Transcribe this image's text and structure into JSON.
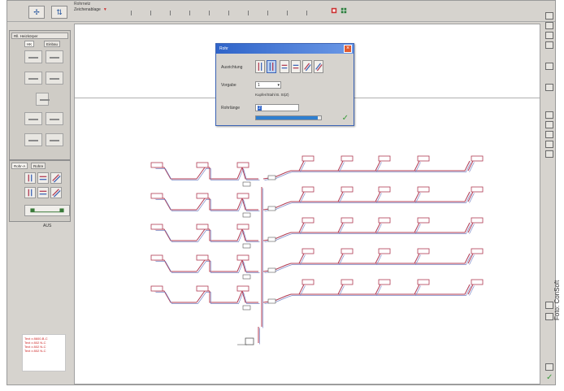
{
  "toolbar": {
    "layer_title": "Rohrnetz",
    "layer_value": "Zeichenablage",
    "layer_arrow": "▼"
  },
  "left_panel": {
    "title": "Rll. Heizkörper",
    "tabs": [
      "HK",
      "Einbau"
    ]
  },
  "left_panel2": {
    "tabs": [
      "Rohr-A",
      "Rohre"
    ],
    "count_label": "AUS"
  },
  "legend": {
    "lines": [
      "Text x 8600-B-C",
      "Text x 802 N-C",
      "Text x 802 N-C",
      "Text x 802 N-C"
    ]
  },
  "dialog": {
    "title": "Rohr",
    "close_glyph": "×",
    "label_ausrichtung": "Ausrichtung",
    "label_vorgabe": "Vorgabe",
    "vorgabe_value": "1",
    "vorgabe_note": "Kupfer/Stahl B. St(Z)",
    "label_rohrlaenge": "Rohrlänge",
    "rohrlaenge_value": "2",
    "progress_fraction": 0.95,
    "ok_glyph": "✓"
  },
  "right_bar": {
    "check_glyph": "✓"
  },
  "photo_credit": "Foto: ConSoft",
  "colors": {
    "pipe_red": "#b03a52",
    "pipe_blue": "#7b89c8",
    "dialog_title": "#2f64c9"
  }
}
